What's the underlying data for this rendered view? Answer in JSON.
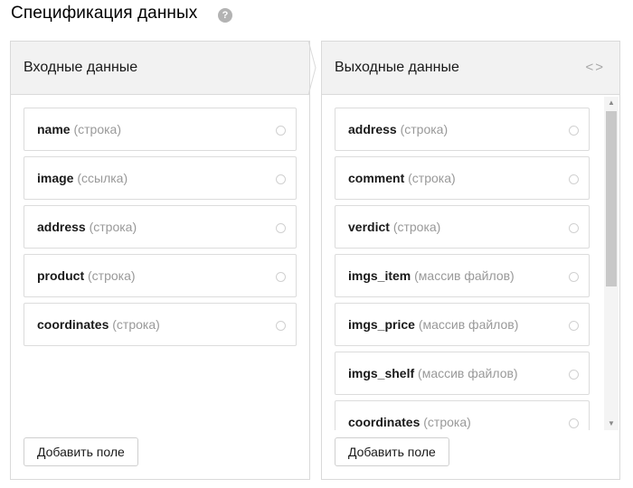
{
  "page": {
    "title": "Спецификация данных",
    "help_icon": "?"
  },
  "input_panel": {
    "title": "Входные данные",
    "fields": [
      {
        "name": "name",
        "type": "(строка)"
      },
      {
        "name": "image",
        "type": "(ссылка)"
      },
      {
        "name": "address",
        "type": "(строка)"
      },
      {
        "name": "product",
        "type": "(строка)"
      },
      {
        "name": "coordinates",
        "type": "(строка)"
      }
    ],
    "add_label": "Добавить поле"
  },
  "output_panel": {
    "title": "Выходные данные",
    "code_icon": "<>",
    "fields": [
      {
        "name": "address",
        "type": "(строка)"
      },
      {
        "name": "comment",
        "type": "(строка)"
      },
      {
        "name": "verdict",
        "type": "(строка)"
      },
      {
        "name": "imgs_item",
        "type": "(массив файлов)"
      },
      {
        "name": "imgs_price",
        "type": "(массив файлов)"
      },
      {
        "name": "imgs_shelf",
        "type": "(массив файлов)"
      },
      {
        "name": "coordinates",
        "type": "(строка)"
      }
    ],
    "add_label": "Добавить поле"
  },
  "colors": {
    "header_bg": "#f2f2f2",
    "border": "#dadada",
    "muted_text": "#999999"
  }
}
